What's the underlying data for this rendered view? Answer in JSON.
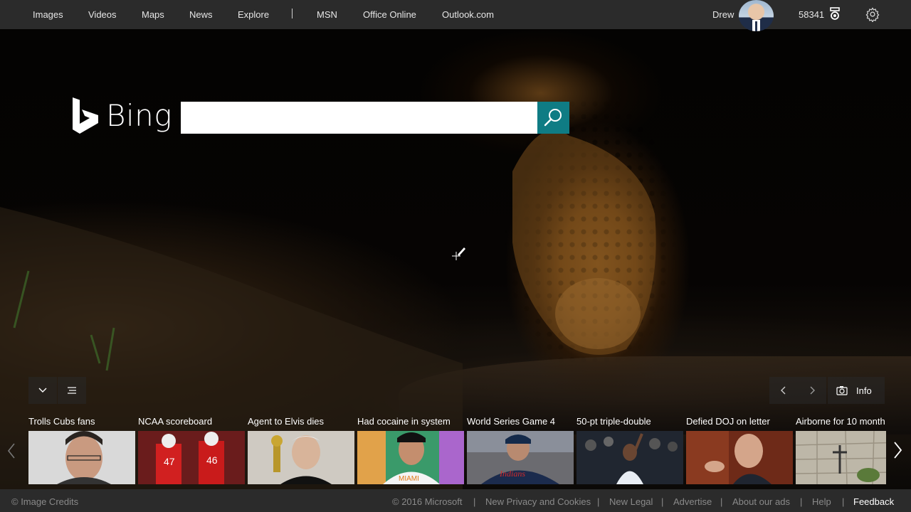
{
  "nav": {
    "items": [
      {
        "label": "Images"
      },
      {
        "label": "Videos"
      },
      {
        "label": "Maps"
      },
      {
        "label": "News"
      },
      {
        "label": "Explore"
      },
      {
        "label": "MSN"
      },
      {
        "label": "Office Online"
      },
      {
        "label": "Outlook.com"
      }
    ]
  },
  "user": {
    "name": "Drew",
    "points": "58341"
  },
  "logo": {
    "text": "Bing"
  },
  "search": {
    "value": "",
    "placeholder": ""
  },
  "controls": {
    "info_label": "Info"
  },
  "news": [
    {
      "title": "Trolls Cubs fans"
    },
    {
      "title": "NCAA scoreboard"
    },
    {
      "title": "Agent to Elvis dies"
    },
    {
      "title": "Had cocaine in system"
    },
    {
      "title": "World Series Game 4"
    },
    {
      "title": "50-pt triple-double"
    },
    {
      "title": "Defied DOJ on letter"
    },
    {
      "title": "Airborne for 10 month"
    }
  ],
  "footer": {
    "credits": "© Image Credits",
    "copyright": "© 2016 Microsoft",
    "links": [
      "New Privacy and Cookies",
      "New Legal",
      "Advertise",
      "About our ads",
      "Help"
    ],
    "feedback": "Feedback"
  },
  "colors": {
    "search_button": "#0f7c84",
    "bar_bg": "#2b2b2b"
  },
  "icons": [
    "bing-logo-icon",
    "search-icon",
    "trophy-icon",
    "gear-icon",
    "chevron-down-icon",
    "menu-lines-icon",
    "chevron-left-icon",
    "chevron-right-icon",
    "camera-icon"
  ]
}
